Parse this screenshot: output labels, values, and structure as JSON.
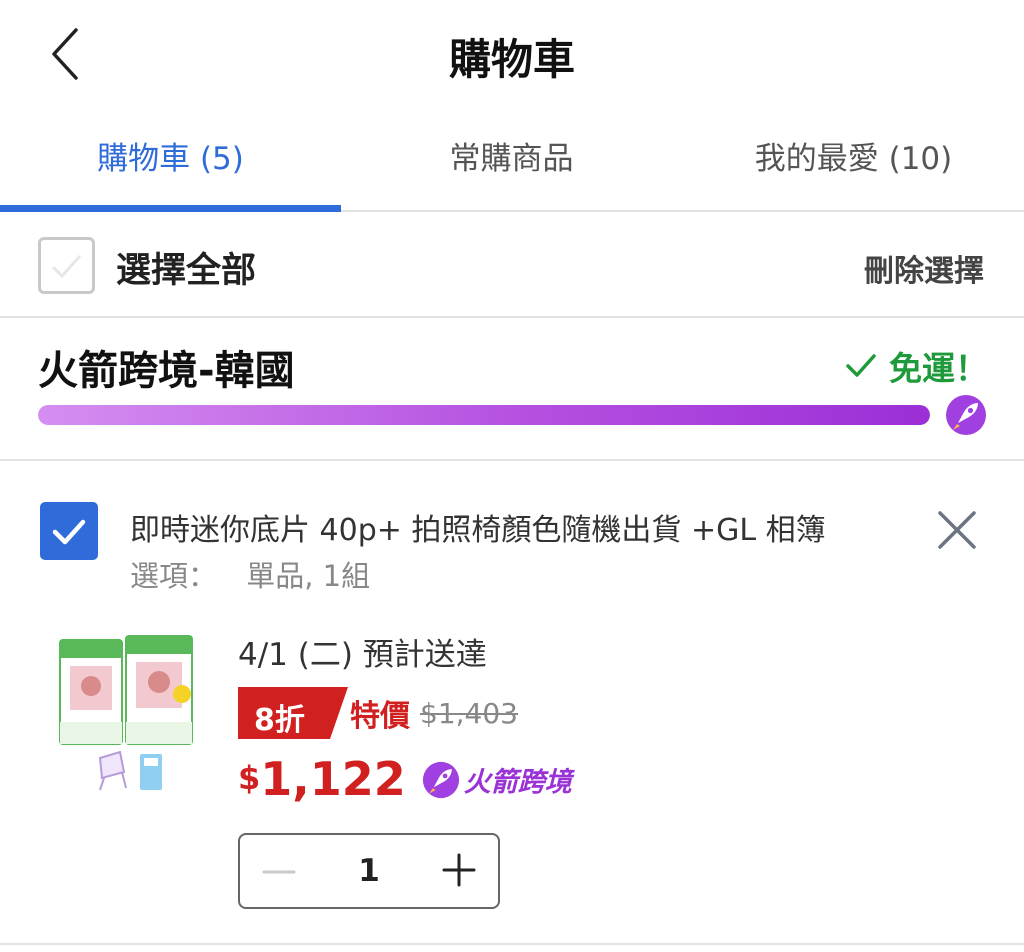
{
  "header": {
    "title": "購物車",
    "back_icon": "chevron-left-icon"
  },
  "tabs": [
    {
      "label": "購物車 (5)",
      "active": true
    },
    {
      "label": "常購商品",
      "active": false
    },
    {
      "label": "我的最愛 (10)",
      "active": false
    }
  ],
  "selection": {
    "select_all_label": "選擇全部",
    "select_all_checked": false,
    "delete_label": "刪除選擇"
  },
  "store": {
    "name": "火箭跨境-韓國",
    "shipping_status": "免運！",
    "shipping_progress": 1.0,
    "progress_colors": [
      "#d58ef0",
      "#9b2fd6"
    ]
  },
  "item": {
    "checked": true,
    "title": "即時迷你底片 40p+ 拍照椅顏色隨機出貨 +GL 相簿",
    "option_label": "選項：",
    "option_value": "單品, 1組",
    "delivery": "4/1 (二) 預計送達",
    "discount_badge": "8折",
    "special_label": "特價",
    "original_price": "$1,403",
    "currency": "$",
    "price": "1,122",
    "tag_label": "火箭跨境",
    "quantity": "1"
  },
  "colors": {
    "accent": "#2f6bd9",
    "price_red": "#d0201f",
    "success_green": "#1f9a3a",
    "rocket_purple": "#9a32d6"
  }
}
